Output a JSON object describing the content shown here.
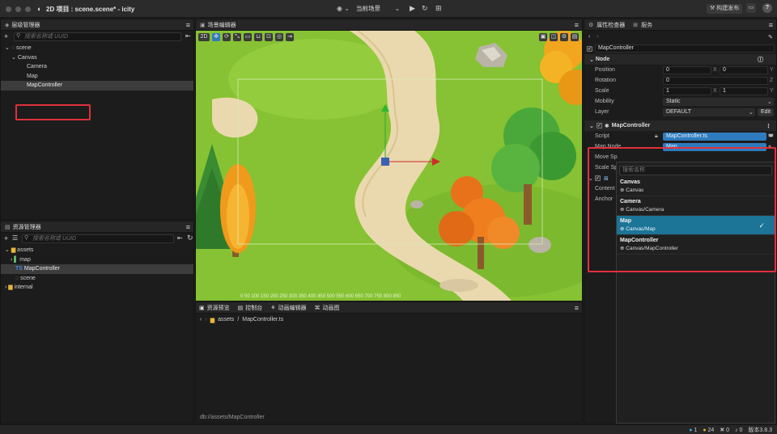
{
  "window": {
    "title": "2D 项目 : scene.scene* - icity",
    "scene_selector": "当前场景",
    "right_buttons": {
      "build": "构建发布"
    },
    "help": "?"
  },
  "hierarchy": {
    "title": "层级管理器",
    "search_placeholder": "搜索名称或 UUID",
    "items": [
      {
        "label": "scene",
        "level": 0,
        "expanded": true,
        "icon": "scene-icon"
      },
      {
        "label": "Canvas",
        "level": 1,
        "expanded": true
      },
      {
        "label": "Camera",
        "level": 2
      },
      {
        "label": "Map",
        "level": 2
      },
      {
        "label": "MapController",
        "level": 2,
        "selected": true
      }
    ]
  },
  "assets": {
    "title": "资源管理器",
    "search_placeholder": "搜索名称或 UUID",
    "items": [
      {
        "label": "assets",
        "level": 0,
        "expanded": true,
        "icon": "folder-icon"
      },
      {
        "label": "map",
        "level": 1,
        "icon": "folder-icon"
      },
      {
        "label": "MapController",
        "level": 1,
        "icon": "ts-icon",
        "selected": true
      },
      {
        "label": "scene",
        "level": 1,
        "icon": "scene-icon"
      },
      {
        "label": "internal",
        "level": 0,
        "icon": "folder-icon"
      }
    ]
  },
  "scene_editor": {
    "title": "场景编辑器",
    "mode_label": "2D",
    "ruler": "0  50  100 150 200 250 300 350 400 450 500 550 600 650 700 750 800 850"
  },
  "bottom_panel": {
    "tabs": [
      "资源预览",
      "控制台",
      "动画编辑器",
      "动画图"
    ],
    "breadcrumb": {
      "folder": "assets",
      "file": "MapController.ts"
    },
    "status": "db://assets/MapController"
  },
  "inspector": {
    "title": "属性检查器",
    "tab2": "服务",
    "node_name": "MapController",
    "node_section": "Node",
    "position": {
      "label": "Position",
      "x": "0",
      "y": "0",
      "ax": "X",
      "ay": "Y"
    },
    "rotation": {
      "label": "Rotation",
      "value": "0",
      "axis": "Z"
    },
    "scale": {
      "label": "Scale",
      "x": "1",
      "y": "1",
      "ax": "X",
      "ay": "Y"
    },
    "mobility": {
      "label": "Mobility",
      "value": "Static"
    },
    "layer": {
      "label": "Layer",
      "value": "DEFAULT",
      "edit": "Edit"
    },
    "component": "MapController",
    "script": {
      "label": "Script",
      "value": "MapController.ts"
    },
    "map_node": {
      "label": "Map Node",
      "value": "Map"
    },
    "move_speed_label": "Move Sp",
    "scale_speed_label": "Scale Sp",
    "content_label": "Content",
    "anchor_label": "Anchor"
  },
  "dropdown": {
    "search_placeholder": "搜索名称",
    "items": [
      {
        "name": "Canvas",
        "path": "Canvas"
      },
      {
        "name": "Camera",
        "path": "Canvas/Camera"
      },
      {
        "name": "Map",
        "path": "Canvas/Map",
        "selected": true
      },
      {
        "name": "MapController",
        "path": "Canvas/MapController"
      }
    ]
  },
  "statusbar": {
    "info": "1",
    "warn": "24",
    "err": "0",
    "notice": "0",
    "version": "版本3.8.3"
  },
  "colors": {
    "accent": "#2f7bbd",
    "selected_row": "#3c3c3c",
    "dropdown_selected": "#1c7496",
    "highlight_box": "#e0313b",
    "grass": "#85c234",
    "path": "#e9dcb6"
  }
}
